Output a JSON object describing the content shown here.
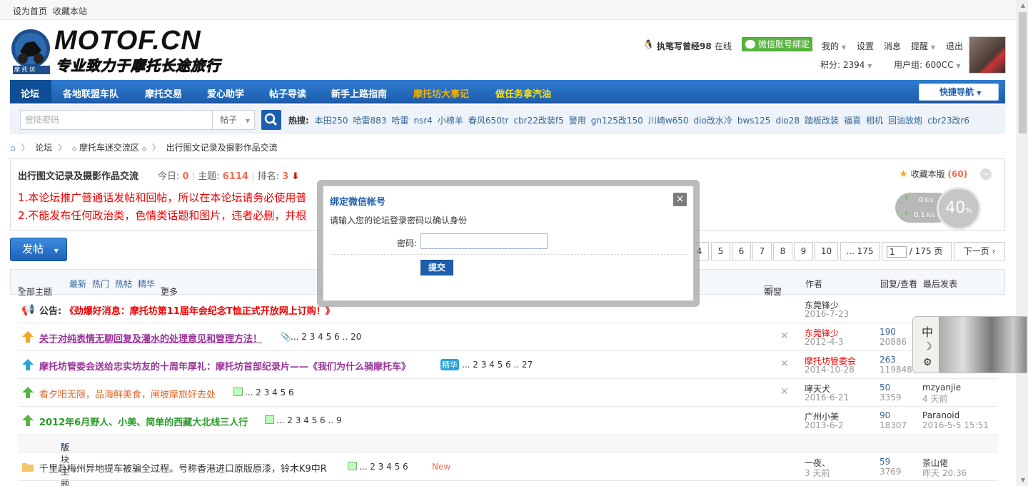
{
  "topbar": {
    "set_home": "设为首页",
    "bookmark": "收藏本站"
  },
  "logo": {
    "brand": "MOTOF.CN",
    "slogan": "专业致力于摩托长途旅行",
    "badge": "摩 托 坊"
  },
  "user": {
    "name": "执笔写曾经98",
    "online": "在线",
    "wechat_bind": "微信账号绑定",
    "my": "我的",
    "settings": "设置",
    "messages": "消息",
    "alerts": "提醒",
    "logout": "退出",
    "points": "积分: 2394",
    "group": "用户组: 600CC"
  },
  "nav": {
    "items": [
      "论坛",
      "各地联盟车队",
      "摩托交易",
      "爱心助学",
      "帖子导读",
      "新手上路指南",
      "摩托坊大事记",
      "做任务拿汽油"
    ],
    "quick_nav": "快捷导航"
  },
  "search": {
    "placeholder": "登陆密码",
    "type": "帖子",
    "hot_label": "热搜:",
    "hot": [
      "本田250",
      "哈雷883",
      "哈雷",
      "nsr4",
      "小棉羊",
      "春风650tr",
      "cbr22改装f5",
      "警用",
      "gn125改150",
      "川崎w650",
      "dio改水冷",
      "bws125",
      "dio28",
      "踏板改装",
      "福喜",
      "相机",
      "回油放炮",
      "cbr23改r6"
    ]
  },
  "breadcrumb": {
    "forum": "论坛",
    "area": "摩托车迷交流区",
    "board": "出行图文记录及摄影作品交流"
  },
  "forum": {
    "title": "出行图文记录及摄影作品交流",
    "today_label": "今日:",
    "today": "0",
    "topics_label": "主题:",
    "topics": "6114",
    "rank_label": "排名:",
    "rank": "3",
    "rule1": "1.本论坛推广普通话发帖和回帖，所以在本论坛请务必使用普",
    "rule2": "2.不能发布任何政治类，色情类话题和图片，违者必删，并根",
    "fav_label": "收藏本版",
    "fav_count": "(60)",
    "speed_up": "0",
    "speed_up_unit": "K/s",
    "speed_down": "0.1",
    "speed_down_unit": "K/s",
    "gauge_value": "40",
    "gauge_unit": "%"
  },
  "post_button": "发帖",
  "pager": {
    "pages": [
      "4",
      "5",
      "6",
      "7",
      "8",
      "9",
      "10",
      "... 175"
    ],
    "current": "1",
    "total": "/ 175 页",
    "next": "下一页"
  },
  "list_header": {
    "all": "全部主题",
    "latest": "最新",
    "hot": "热门",
    "hot_posts": "热帖",
    "digest": "精华",
    "more": "更多",
    "new_window": "新窗",
    "author": "作者",
    "replies": "回复/查看",
    "last": "最后发表"
  },
  "announcement": {
    "label": "公告:",
    "title": "《劲爆好消息：摩托坊第11届年会纪念T恤正式开放网上订购！》",
    "author": "东莞锋少",
    "date": "2016-7-23"
  },
  "rows": [
    {
      "title": "关于对纯表情无聊回复及灌水的处理意见和管理方法！",
      "pages": "... 2  3  4  5  6 .. 20",
      "author": "东莞锋少",
      "date": "2012-4-3",
      "replies": "190",
      "views": "20886",
      "last_user": "",
      "last_time": ""
    },
    {
      "title": "摩托坊管委会送给忠实坊友的十周年厚礼：摩托坊首部纪录片——《我们为什么骑摩托车》",
      "tag": "精华",
      "pages": "... 2  3  4  5  6 .. 27",
      "author": "摩托坊管委会",
      "date": "2014-10-28",
      "replies": "263",
      "views": "119848",
      "last_user": "",
      "last_time": ""
    },
    {
      "title": "看夕阳无限，品海鲜美食，闸坡摩旅好去处",
      "pages": "... 2  3  4  5  6",
      "author": "哮天犬",
      "date": "2016-6-21",
      "replies": "50",
      "views": "3359",
      "last_user": "mzyanjie",
      "last_time": "4 天前"
    },
    {
      "title": "2012年6月野人、小美、简单的西藏大北线三人行",
      "pages": "... 2  3  4  5  6 .. 9",
      "author": "广州小美",
      "date": "2013-6-2",
      "replies": "90",
      "views": "18307",
      "last_user": "Paranoid",
      "last_time": "2016-5-5 15:51"
    }
  ],
  "section_label": "版块主题",
  "normal_rows": [
    {
      "title": "千里赴梅州异地提车被骗全过程。号称香港进口原版原漆，铃木K9中R",
      "pages": "... 2  3  4  5  6",
      "new": "New",
      "author": "一夜、",
      "date": "3 天前",
      "replies": "59",
      "views": "3769",
      "last_user": "茶山佬",
      "last_time": "昨天 20:36"
    }
  ],
  "widget": {
    "lang": "中",
    "moon": "☽",
    "gear": "⚙"
  },
  "dialog": {
    "title": "绑定微信帐号",
    "description": "请输入您的论坛登录密码以确认身份",
    "password_label": "密码:",
    "submit": "提交",
    "close": "×"
  },
  "colors": {
    "nav": "#1d5fae",
    "accent": "#f26c4f",
    "red": "#e00000",
    "purple": "#993399",
    "green": "#2a9a2a"
  }
}
